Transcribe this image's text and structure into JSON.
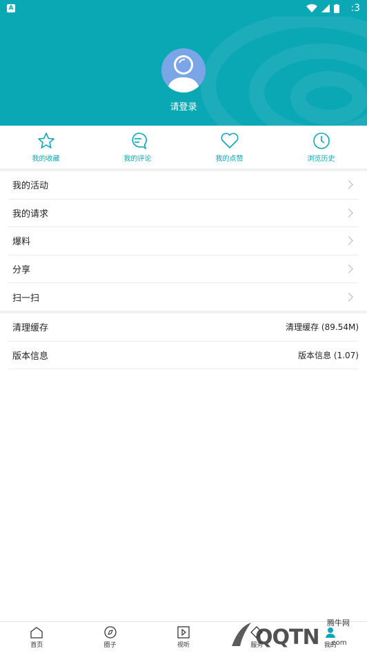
{
  "status_bar": {
    "time": ":3"
  },
  "header": {
    "login_text": "请登录"
  },
  "quick_actions": [
    {
      "label": "我的收藏",
      "icon": "star-icon"
    },
    {
      "label": "我的评论",
      "icon": "comment-icon"
    },
    {
      "label": "我的点赞",
      "icon": "heart-icon"
    },
    {
      "label": "浏览历史",
      "icon": "clock-icon"
    }
  ],
  "menu": [
    {
      "label": "我的活动"
    },
    {
      "label": "我的请求"
    },
    {
      "label": "爆料"
    },
    {
      "label": "分享"
    },
    {
      "label": "扫一扫"
    }
  ],
  "settings": [
    {
      "label": "清理缓存",
      "value": "清理缓存 (89.54M)"
    },
    {
      "label": "版本信息",
      "value": "版本信息 (1.07)"
    }
  ],
  "tabbar": [
    {
      "label": "首页",
      "icon": "home-icon"
    },
    {
      "label": "圈子",
      "icon": "compass-icon"
    },
    {
      "label": "视听",
      "icon": "play-icon"
    },
    {
      "label": "服务",
      "icon": "service-icon"
    },
    {
      "label": "我的",
      "icon": "user-icon"
    }
  ],
  "watermark": {
    "main": "QQTN",
    "top": "腾牛网",
    "bottom": ".com"
  },
  "colors": {
    "primary": "#0aa7b5",
    "avatar_bg": "#7aa6e8"
  }
}
